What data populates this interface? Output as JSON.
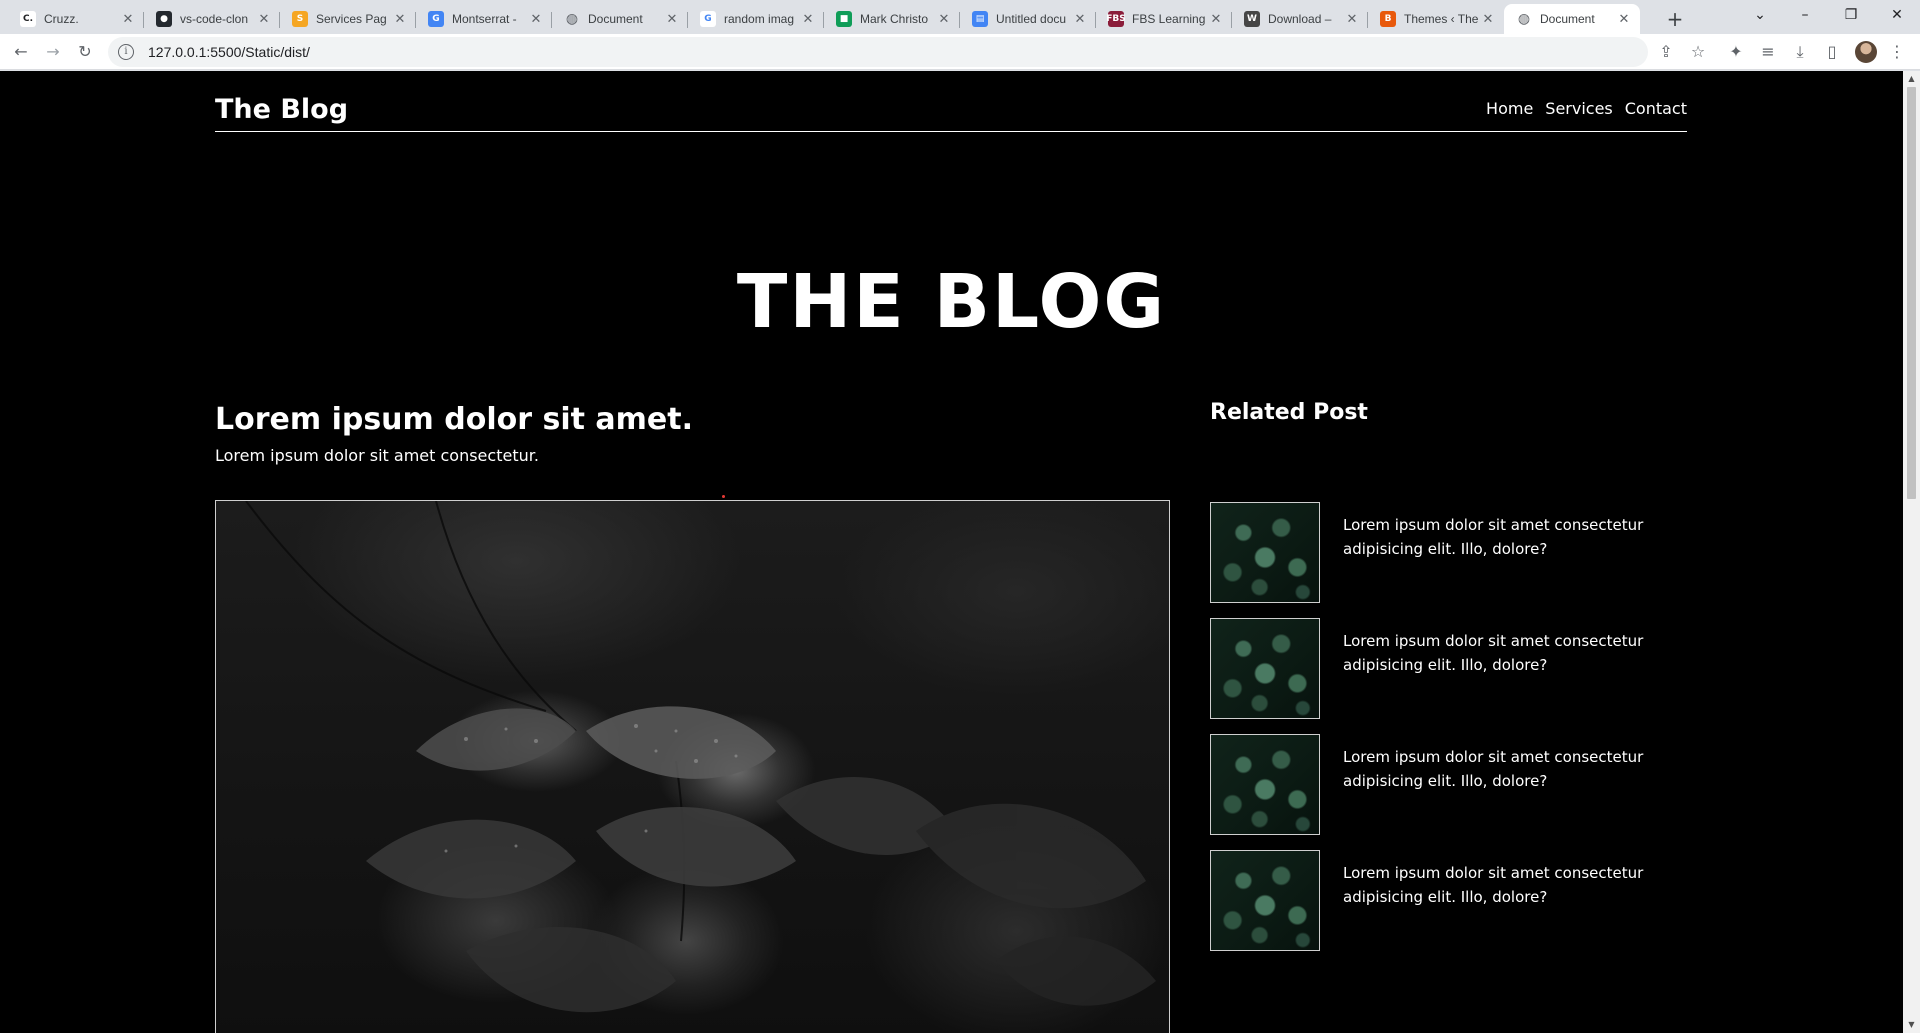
{
  "browser": {
    "tabs": [
      {
        "title": "Cruzz.",
        "favicon": "C.",
        "color": "#ffffff",
        "fg": "#202124",
        "active": false
      },
      {
        "title": "vs-code-clon",
        "favicon": "github-icon",
        "color": "#24292f",
        "fg": "#ffffff",
        "active": false
      },
      {
        "title": "Services Pag",
        "favicon": "S",
        "color": "#f5a623",
        "fg": "#ffffff",
        "active": false
      },
      {
        "title": "Montserrat -",
        "favicon": "G",
        "color": "#4285f4",
        "fg": "#ffffff",
        "active": false
      },
      {
        "title": "Document",
        "favicon": "globe-icon",
        "color": "#5f6368",
        "fg": "#ffffff",
        "active": false
      },
      {
        "title": "random imag",
        "favicon": "G",
        "color": "#ffffff",
        "fg": "#4285f4",
        "active": false
      },
      {
        "title": "Mark Christo",
        "favicon": "chat-icon",
        "color": "#0f9d58",
        "fg": "#ffffff",
        "active": false
      },
      {
        "title": "Untitled docu",
        "favicon": "docs-icon",
        "color": "#4285f4",
        "fg": "#ffffff",
        "active": false
      },
      {
        "title": "FBS Learning",
        "favicon": "FBS",
        "color": "#8b1d3a",
        "fg": "#ffffff",
        "active": false
      },
      {
        "title": "Download –",
        "favicon": "W",
        "color": "#464646",
        "fg": "#ffffff",
        "active": false
      },
      {
        "title": "Themes ‹ The",
        "favicon": "B",
        "color": "#e8590c",
        "fg": "#ffffff",
        "active": false
      },
      {
        "title": "Document",
        "favicon": "globe-icon",
        "color": "#5f6368",
        "fg": "#ffffff",
        "active": true
      }
    ],
    "new_tab_symbol": "+",
    "window_controls": {
      "tab_search": "⌄",
      "minimize": "–",
      "restore": "❐",
      "close": "✕"
    },
    "url": "127.0.0.1:5500/Static/dist/",
    "nav": {
      "back": "←",
      "forward": "→",
      "reload": "↻"
    },
    "toolbar_icons": {
      "share": "⇪",
      "bookmark": "☆",
      "extensions": "✦",
      "media": "≡",
      "download": "⤓",
      "sidepanel": "▯",
      "menu": "⋮"
    }
  },
  "site": {
    "logo": "The Blog",
    "nav": [
      "Home",
      "Services",
      "Contact"
    ],
    "hero_title": "THE BLOG",
    "post": {
      "title": "Lorem ipsum dolor sit amet.",
      "subtitle": "Lorem ipsum dolor sit amet consectetur."
    },
    "related": {
      "heading": "Related Post",
      "items": [
        {
          "text": "Lorem ipsum dolor sit amet consectetur adipisicing elit. Illo, dolore?"
        },
        {
          "text": "Lorem ipsum dolor sit amet consectetur adipisicing elit. Illo, dolore?"
        },
        {
          "text": "Lorem ipsum dolor sit amet consectetur adipisicing elit. Illo, dolore?"
        },
        {
          "text": "Lorem ipsum dolor sit amet consectetur adipisicing elit. Illo, dolore?"
        }
      ]
    }
  },
  "colors": {
    "page_bg": "#000000",
    "text": "#ffffff",
    "chrome_bg": "#dee1e6",
    "omnibox_bg": "#f1f3f4"
  }
}
